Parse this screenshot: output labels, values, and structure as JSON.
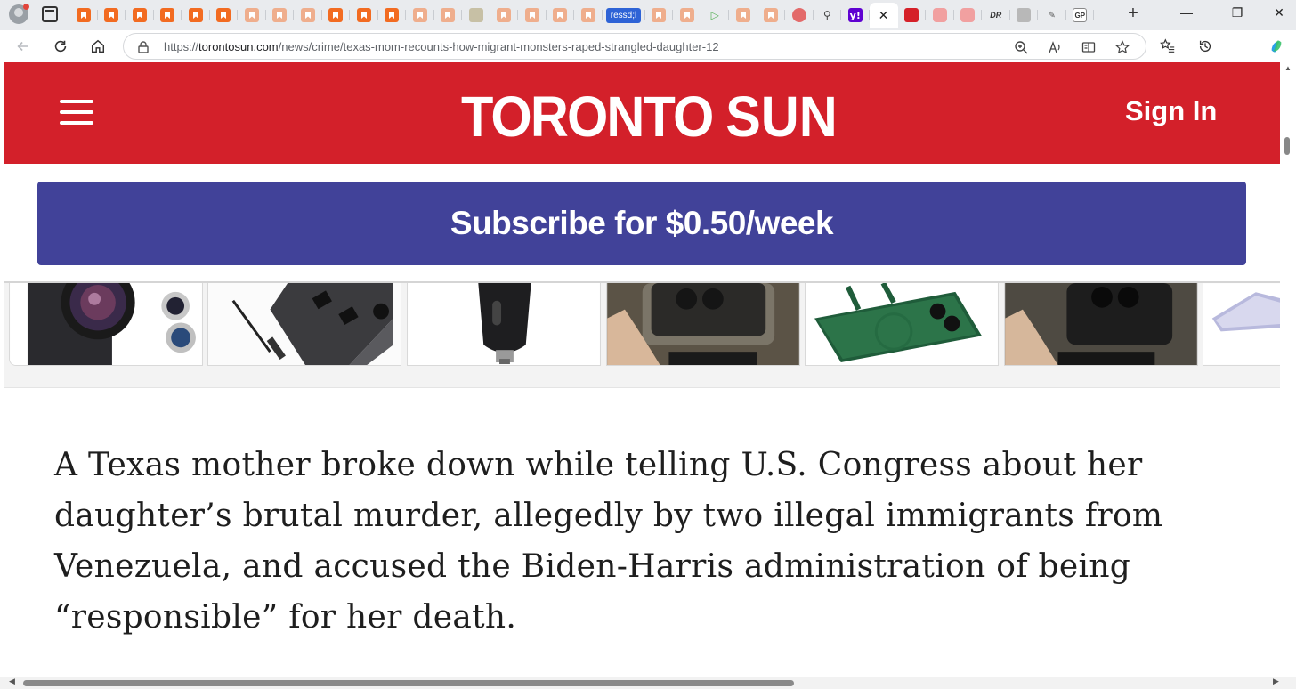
{
  "browser": {
    "tabs": [
      {
        "favicon": "orange-bookmark-icon",
        "faded": false
      },
      {
        "favicon": "orange-bookmark-icon",
        "faded": false
      },
      {
        "favicon": "orange-bookmark-icon",
        "faded": false
      },
      {
        "favicon": "orange-bookmark-icon",
        "faded": false
      },
      {
        "favicon": "orange-bookmark-icon",
        "faded": false
      },
      {
        "favicon": "orange-bookmark-icon",
        "faded": false
      },
      {
        "favicon": "orange-bookmark-icon",
        "faded": true
      },
      {
        "favicon": "orange-bookmark-icon",
        "faded": true
      },
      {
        "favicon": "orange-bookmark-icon",
        "faded": true
      },
      {
        "favicon": "orange-bookmark-icon",
        "faded": false
      },
      {
        "favicon": "orange-bookmark-icon",
        "faded": false
      },
      {
        "favicon": "orange-bookmark-icon",
        "faded": false
      },
      {
        "favicon": "orange-bookmark-icon",
        "faded": true
      },
      {
        "favicon": "orange-bookmark-icon",
        "faded": true
      },
      {
        "favicon": "map-icon"
      },
      {
        "favicon": "orange-bookmark-icon",
        "faded": true
      },
      {
        "favicon": "orange-bookmark-icon",
        "faded": true
      },
      {
        "favicon": "orange-bookmark-icon",
        "faded": true
      },
      {
        "favicon": "orange-bookmark-icon",
        "faded": true
      },
      {
        "favicon": "text-pill",
        "label": "ressd;l"
      },
      {
        "favicon": "orange-bookmark-icon",
        "faded": true
      },
      {
        "favicon": "orange-bookmark-icon",
        "faded": true
      },
      {
        "favicon": "play-icon"
      },
      {
        "favicon": "orange-bookmark-icon",
        "faded": true
      },
      {
        "favicon": "orange-bookmark-icon",
        "faded": true
      },
      {
        "favicon": "microphone-icon"
      },
      {
        "favicon": "search-icon"
      },
      {
        "favicon": "yahoo-icon",
        "label": "y!"
      },
      {
        "favicon": "close-icon",
        "active": true
      },
      {
        "favicon": "toronto-sun-icon"
      },
      {
        "favicon": "youtube-icon"
      },
      {
        "favicon": "youtube-icon"
      },
      {
        "favicon": "dr-icon",
        "label": "DR"
      },
      {
        "favicon": "photo-icon"
      },
      {
        "favicon": "pen-icon"
      },
      {
        "favicon": "gp-icon",
        "label": "GP"
      }
    ],
    "new_tab_label": "+",
    "window_controls": [
      "—",
      "❐",
      "✕"
    ],
    "url": {
      "scheme": "https://",
      "host": "torontosun.com",
      "path": "/news/crime/texas-mom-recounts-how-migrant-monsters-raped-strangled-daughter-12"
    }
  },
  "site": {
    "brand_color": "#d3202a",
    "logo_left": "TORONTO",
    "logo_right": "SUN",
    "sign_in_label": "Sign In",
    "subscribe_label": "Subscribe for $0.50/week",
    "subscribe_color": "#414299"
  },
  "ads": [
    {
      "name": "ad-camera-lens-kit"
    },
    {
      "name": "ad-car-power-inverter"
    },
    {
      "name": "ad-car-charger"
    },
    {
      "name": "ad-phone-case-gold"
    },
    {
      "name": "ad-phone-case-green-stand"
    },
    {
      "name": "ad-phone-case-black"
    },
    {
      "name": "ad-phone-case-clear"
    }
  ],
  "article": {
    "lead_paragraph": "A Texas mother broke down while telling U.S. Congress about her daughter’s brutal murder, allegedly by two illegal immigrants from Venezuela, and accused the Biden-Harris administration of being “responsible” for her death."
  }
}
